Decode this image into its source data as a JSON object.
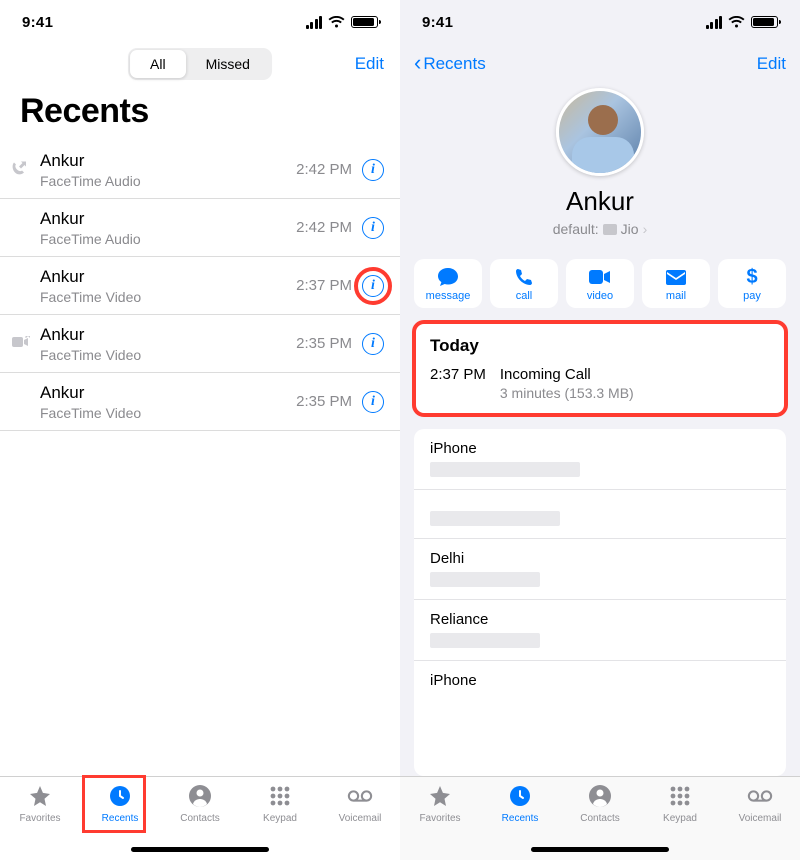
{
  "status": {
    "time": "9:41"
  },
  "left": {
    "segment": {
      "all": "All",
      "missed": "Missed"
    },
    "edit": "Edit",
    "title": "Recents",
    "calls": [
      {
        "name": "Ankur",
        "sub": "FaceTime Audio",
        "time": "2:42 PM",
        "icon": "outgoing"
      },
      {
        "name": "Ankur",
        "sub": "FaceTime Audio",
        "time": "2:42 PM"
      },
      {
        "name": "Ankur",
        "sub": "FaceTime Video",
        "time": "2:37 PM",
        "highlight": true
      },
      {
        "name": "Ankur",
        "sub": "FaceTime Video",
        "time": "2:35 PM",
        "icon": "video-out"
      },
      {
        "name": "Ankur",
        "sub": "FaceTime Video",
        "time": "2:35 PM"
      }
    ]
  },
  "right": {
    "back": "Recents",
    "edit": "Edit",
    "contact_name": "Ankur",
    "default_prefix": "default:",
    "default_sim": "Jio",
    "actions": {
      "message": "message",
      "call": "call",
      "video": "video",
      "mail": "mail",
      "pay": "pay"
    },
    "today": {
      "header": "Today",
      "time": "2:37 PM",
      "type": "Incoming Call",
      "duration": "3 minutes (153.3 MB)"
    },
    "fields": [
      {
        "label": "iPhone"
      },
      {
        "label": ""
      },
      {
        "label": "Delhi"
      },
      {
        "label": "Reliance"
      },
      {
        "label": "iPhone"
      }
    ]
  },
  "tabs": {
    "favorites": "Favorites",
    "recents": "Recents",
    "contacts": "Contacts",
    "keypad": "Keypad",
    "voicemail": "Voicemail"
  }
}
